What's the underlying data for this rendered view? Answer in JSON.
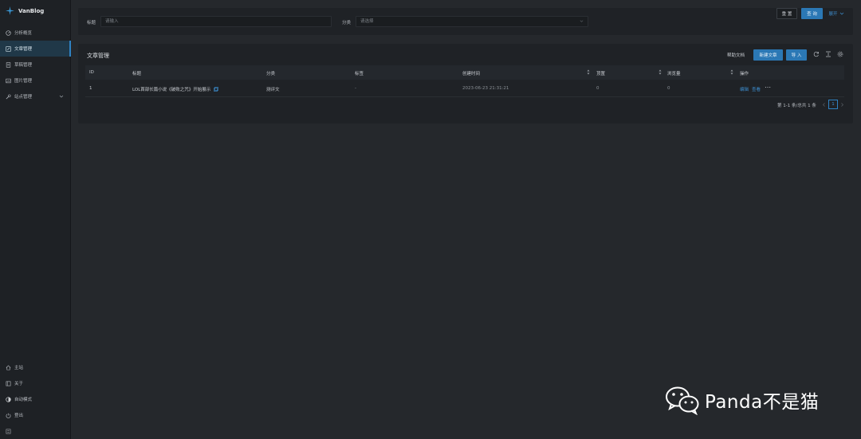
{
  "brand": {
    "name": "VanBlog"
  },
  "nav": {
    "items": [
      {
        "label": "分析概览",
        "icon": "dashboard-icon"
      },
      {
        "label": "文章管理",
        "icon": "edit-icon",
        "active": true
      },
      {
        "label": "草稿管理",
        "icon": "file-icon"
      },
      {
        "label": "图片管理",
        "icon": "image-icon"
      },
      {
        "label": "站点管理",
        "icon": "tool-icon",
        "expandable": true
      }
    ],
    "bottom": [
      {
        "label": "主站",
        "icon": "home-icon"
      },
      {
        "label": "关于",
        "icon": "book-icon"
      },
      {
        "label": "自动模式",
        "icon": "theme-icon"
      },
      {
        "label": "登出",
        "icon": "logout-icon"
      },
      {
        "label": "",
        "icon": "menu-icon"
      }
    ]
  },
  "search": {
    "title_label": "标题",
    "title_placeholder": "请输入",
    "category_label": "分类",
    "category_placeholder": "请选择",
    "reset_label": "重 置",
    "query_label": "查 询",
    "expand_label": "展开"
  },
  "table": {
    "title": "文章管理",
    "help_label": "帮助文档",
    "new_label": "新建文章",
    "import_label": "导 入",
    "columns": [
      "ID",
      "标题",
      "分类",
      "标签",
      "创建时间",
      "顶置",
      "浏览量",
      "操作"
    ],
    "rows": [
      {
        "id": "1",
        "title": "LOL首部长篇小说《破败之咒》开始展示",
        "category": "测评文",
        "tags": "-",
        "created": "2023-06-23 21:31:21",
        "top": "0",
        "views": "0",
        "edit": "编辑",
        "view": "查看",
        "more": "⋯"
      }
    ],
    "pagination": {
      "summary": "第 1-1 条/总共 1 条",
      "current": "1"
    }
  },
  "watermark": {
    "text": "Panda不是猫"
  },
  "colors": {
    "accent": "#2b78b5",
    "link": "#3d8fd1",
    "sidebar_bg": "#1e2125",
    "page_bg": "#25282c"
  }
}
